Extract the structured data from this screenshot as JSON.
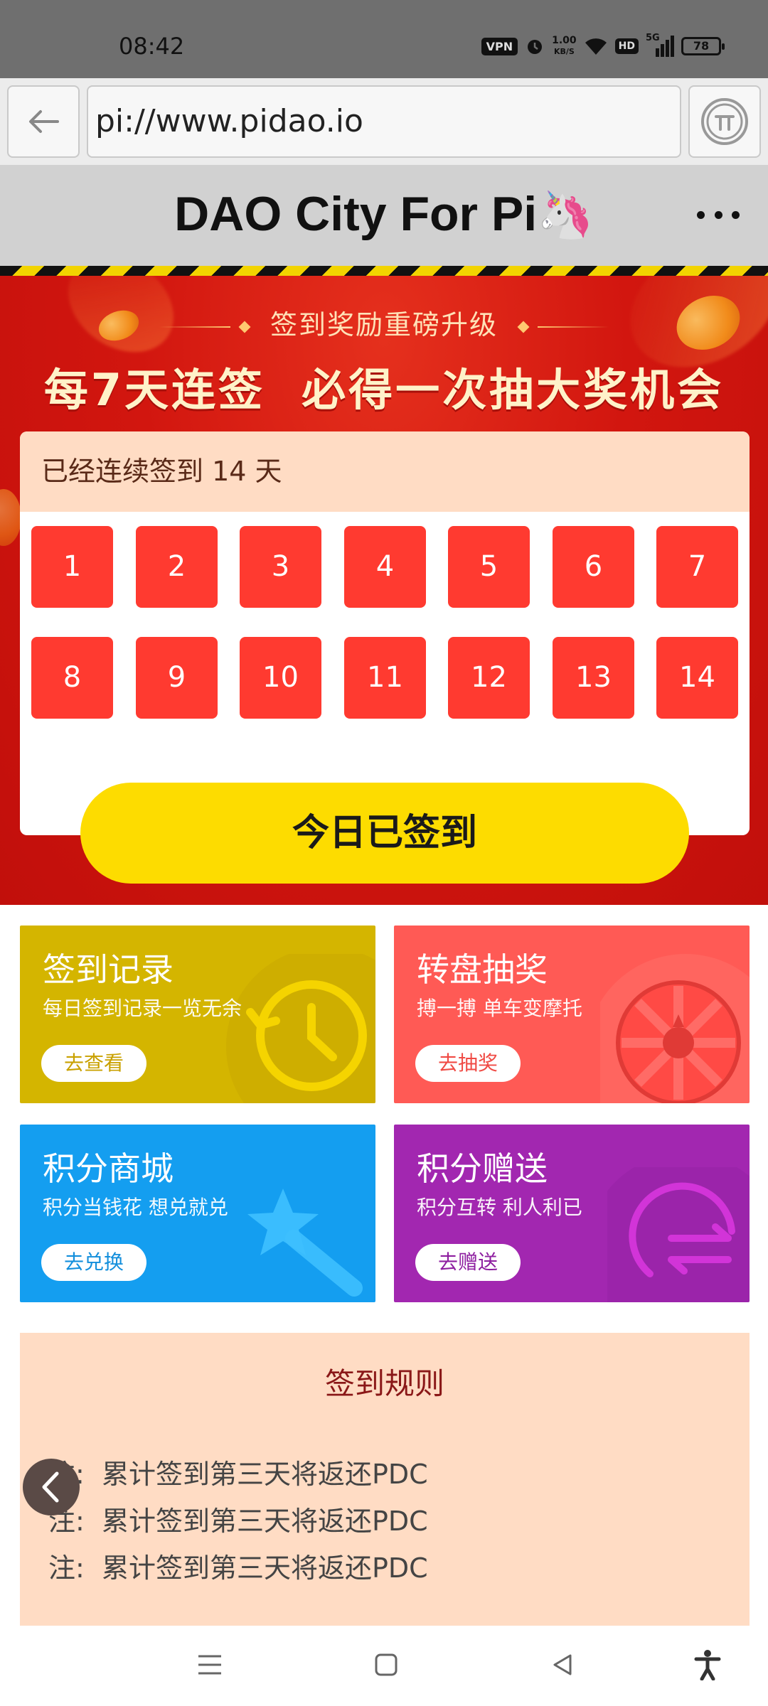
{
  "status_bar": {
    "time": "08:42",
    "vpn": "VPN",
    "net_speed_value": "1.00",
    "net_speed_unit": "KB/S",
    "hd": "HD",
    "signal": "5G",
    "battery": "78"
  },
  "browser": {
    "url": "pi://www.pidao.io"
  },
  "header": {
    "title": "DAO City For Pi",
    "emoji": "🦄"
  },
  "banner": {
    "subtitle": "签到奖励重磅升级",
    "headline": "每7天连签  必得一次抽大奖机会"
  },
  "calendar": {
    "streak_text": "已经连续签到 14 天",
    "days": [
      "1",
      "2",
      "3",
      "4",
      "5",
      "6",
      "7",
      "8",
      "9",
      "10",
      "11",
      "12",
      "13",
      "14"
    ],
    "checkin_button": "今日已签到"
  },
  "tiles": [
    {
      "title": "签到记录",
      "desc": "每日签到记录一览无余",
      "button": "去查看",
      "color": "#d4b500",
      "icon": "clock-history-icon"
    },
    {
      "title": "转盘抽奖",
      "desc": "搏一搏 单车变摩托",
      "button": "去抽奖",
      "color": "#ff5a55",
      "icon": "prize-wheel-icon"
    },
    {
      "title": "积分商城",
      "desc": "积分当钱花 想兑就兑",
      "button": "去兑换",
      "color": "#149ef0",
      "icon": "magic-wand-icon"
    },
    {
      "title": "积分赠送",
      "desc": "积分互转 利人利已",
      "button": "去赠送",
      "color": "#a227b0",
      "icon": "transfer-arrows-icon"
    }
  ],
  "rules": {
    "title": "签到规则",
    "items": [
      "注:  累计签到第三天将返还PDC",
      "注:  累计签到第三天将返还PDC",
      "注:  累计签到第三天将返还PDC"
    ]
  }
}
